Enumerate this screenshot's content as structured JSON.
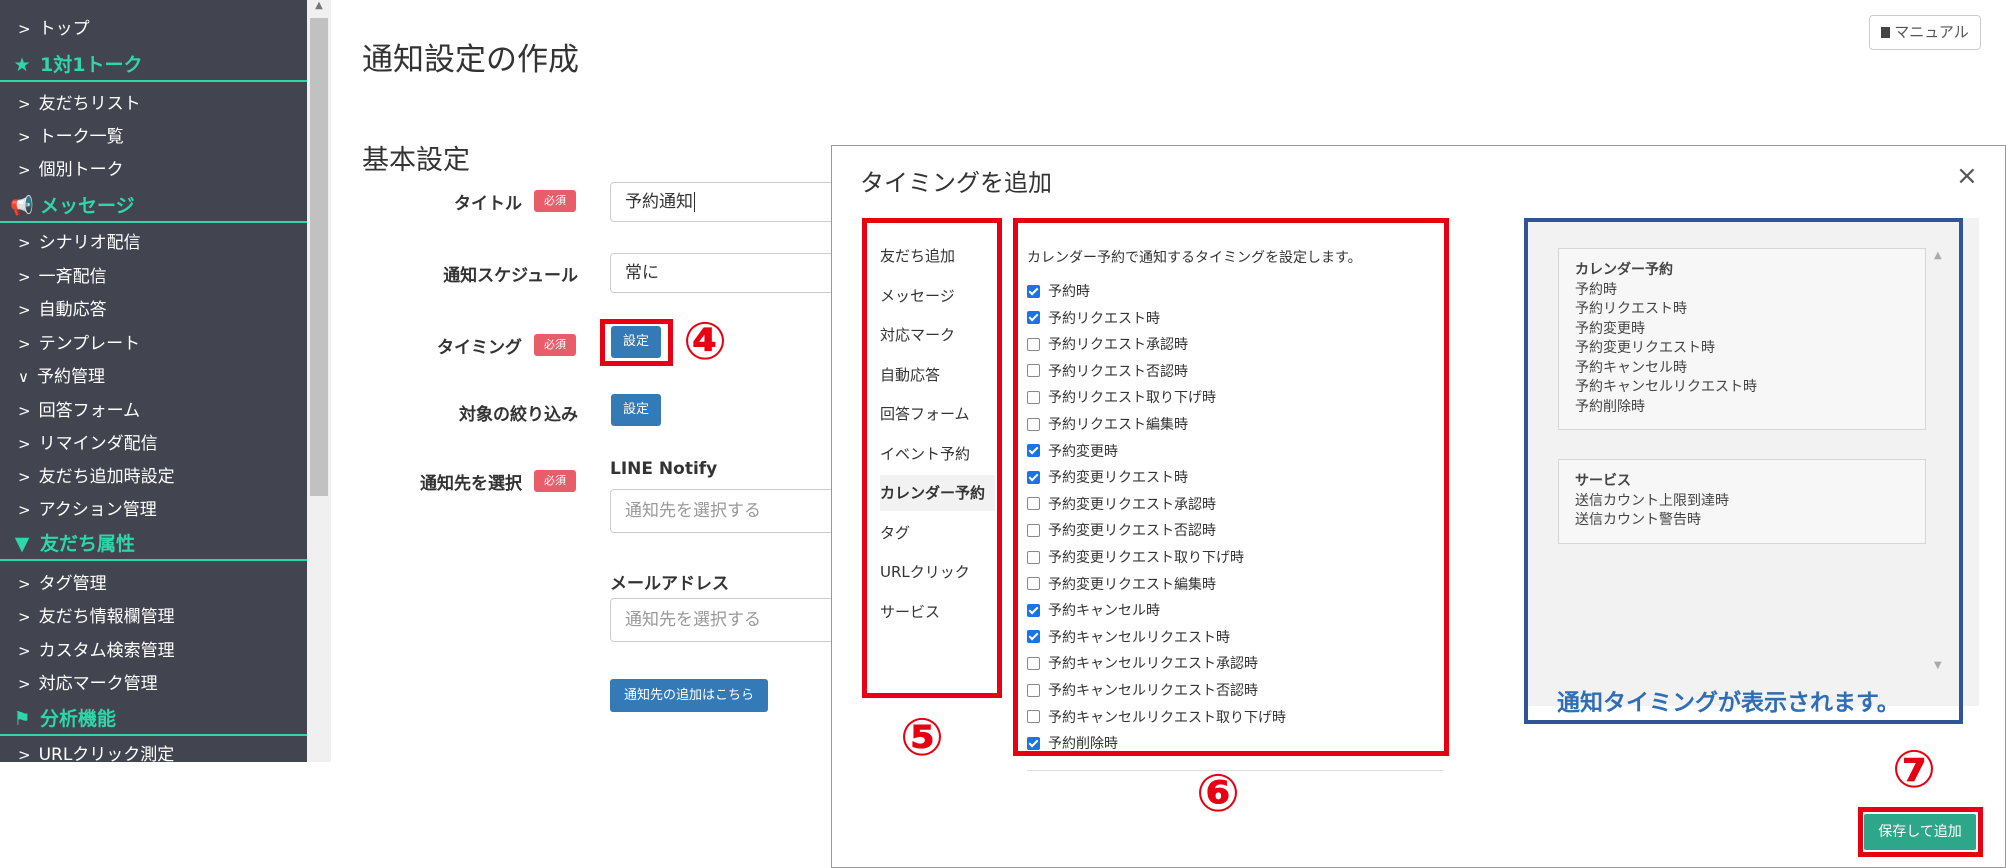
{
  "sidebar": {
    "items": [
      {
        "type": "item",
        "label": "トップ"
      },
      {
        "type": "head",
        "label": "1対1トーク",
        "icon": "star-icon"
      },
      {
        "type": "item",
        "label": "友だちリスト"
      },
      {
        "type": "item",
        "label": "トーク一覧"
      },
      {
        "type": "item",
        "label": "個別トーク"
      },
      {
        "type": "head",
        "label": "メッセージ",
        "icon": "megaphone-icon"
      },
      {
        "type": "item",
        "label": "シナリオ配信"
      },
      {
        "type": "item",
        "label": "一斉配信"
      },
      {
        "type": "item",
        "label": "自動応答"
      },
      {
        "type": "item",
        "label": "テンプレート"
      },
      {
        "type": "item",
        "label": "予約管理",
        "expanded": true
      },
      {
        "type": "item",
        "label": "回答フォーム"
      },
      {
        "type": "item",
        "label": "リマインダ配信"
      },
      {
        "type": "item",
        "label": "友だち追加時設定"
      },
      {
        "type": "item",
        "label": "アクション管理"
      },
      {
        "type": "head",
        "label": "友だち属性",
        "icon": "filter-icon"
      },
      {
        "type": "item",
        "label": "タグ管理"
      },
      {
        "type": "item",
        "label": "友だち情報欄管理"
      },
      {
        "type": "item",
        "label": "カスタム検索管理"
      },
      {
        "type": "item",
        "label": "対応マーク管理"
      },
      {
        "type": "head",
        "label": "分析機能",
        "icon": "flag-icon"
      },
      {
        "type": "item",
        "label": "URLクリック測定"
      }
    ]
  },
  "header": {
    "title": "通知設定の作成",
    "manual_label": "マニュアル"
  },
  "form": {
    "section_title": "基本設定",
    "required_label": "必須",
    "title_label": "タイトル",
    "title_value": "予約通知",
    "schedule_label": "通知スケジュール",
    "schedule_value": "常に",
    "timing_label": "タイミング",
    "timing_button": "設定",
    "filter_label": "対象の絞り込み",
    "filter_button": "設定",
    "destination_label": "通知先を選択",
    "line_notify_label": "LINE Notify",
    "line_notify_placeholder": "通知先を選択する",
    "email_label": "メールアドレス",
    "email_placeholder": "通知先を選択する",
    "add_destination_button": "通知先の追加はこちら"
  },
  "annotations": {
    "n4": "④",
    "n5": "⑤",
    "n6": "⑥",
    "n7": "⑦",
    "accent_red": "#e60012",
    "accent_blue": "#2f5597"
  },
  "modal": {
    "title": "タイミングを追加",
    "close_label": "×",
    "categories": [
      {
        "label": "友だち追加",
        "active": false
      },
      {
        "label": "メッセージ",
        "active": false
      },
      {
        "label": "対応マーク",
        "active": false
      },
      {
        "label": "自動応答",
        "active": false
      },
      {
        "label": "回答フォーム",
        "active": false
      },
      {
        "label": "イベント予約",
        "active": false
      },
      {
        "label": "カレンダー予約",
        "active": true
      },
      {
        "label": "タグ",
        "active": false
      },
      {
        "label": "URLクリック",
        "active": false
      },
      {
        "label": "サービス",
        "active": false
      }
    ],
    "description": "カレンダー予約で通知するタイミングを設定します。",
    "options": [
      {
        "label": "予約時",
        "checked": true
      },
      {
        "label": "予約リクエスト時",
        "checked": true
      },
      {
        "label": "予約リクエスト承認時",
        "checked": false
      },
      {
        "label": "予約リクエスト否認時",
        "checked": false
      },
      {
        "label": "予約リクエスト取り下げ時",
        "checked": false
      },
      {
        "label": "予約リクエスト編集時",
        "checked": false
      },
      {
        "label": "予約変更時",
        "checked": true
      },
      {
        "label": "予約変更リクエスト時",
        "checked": true
      },
      {
        "label": "予約変更リクエスト承認時",
        "checked": false
      },
      {
        "label": "予約変更リクエスト否認時",
        "checked": false
      },
      {
        "label": "予約変更リクエスト取り下げ時",
        "checked": false
      },
      {
        "label": "予約変更リクエスト編集時",
        "checked": false
      },
      {
        "label": "予約キャンセル時",
        "checked": true
      },
      {
        "label": "予約キャンセルリクエスト時",
        "checked": true
      },
      {
        "label": "予約キャンセルリクエスト承認時",
        "checked": false
      },
      {
        "label": "予約キャンセルリクエスト否認時",
        "checked": false
      },
      {
        "label": "予約キャンセルリクエスト取り下げ時",
        "checked": false
      },
      {
        "label": "予約削除時",
        "checked": true
      }
    ],
    "preview": [
      {
        "head": "カレンダー予約",
        "lines": [
          "予約時",
          "予約リクエスト時",
          "予約変更時",
          "予約変更リクエスト時",
          "予約キャンセル時",
          "予約キャンセルリクエスト時",
          "予約削除時"
        ]
      },
      {
        "head": "サービス",
        "lines": [
          "送信カウント上限到達時",
          "送信カウント警告時"
        ]
      }
    ],
    "preview_note": "通知タイミングが表示されます。",
    "save_button": "保存して追加"
  }
}
